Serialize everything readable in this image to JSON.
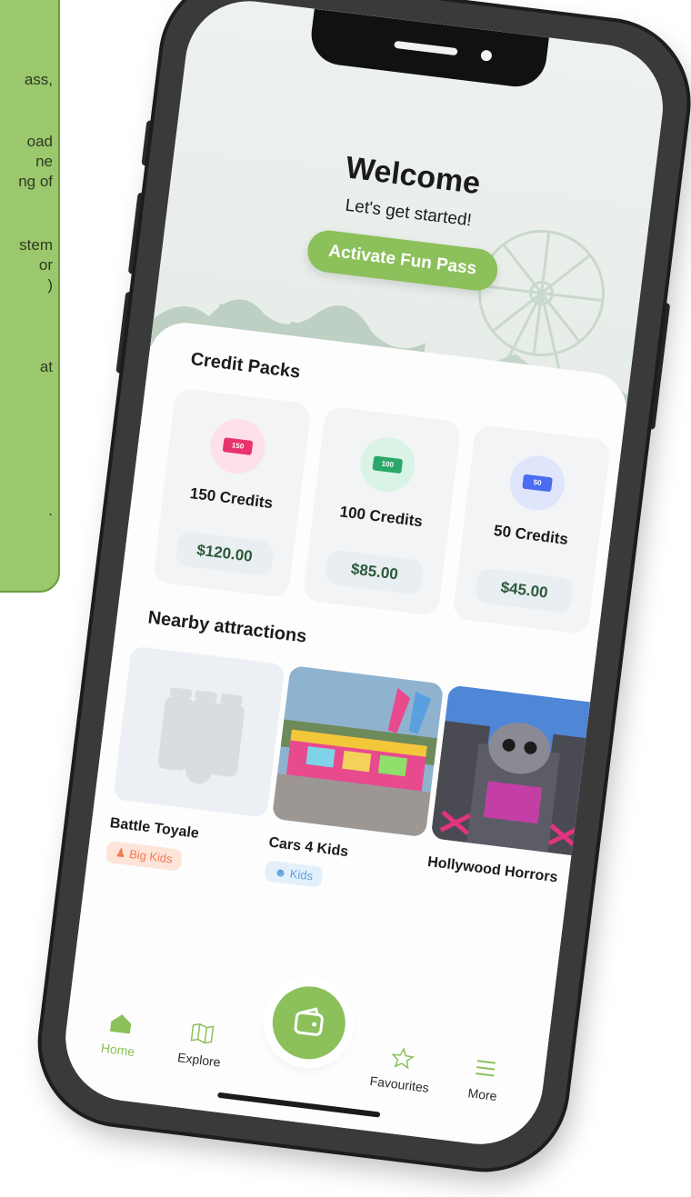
{
  "note": {
    "lines": [
      "ass,",
      "oad",
      "ne",
      "ng of",
      "stem",
      "or",
      ")",
      "at",
      "."
    ]
  },
  "hero": {
    "title": "Welcome",
    "subtitle": "Let's get started!",
    "cta_label": "Activate Fun Pass"
  },
  "credit_packs": {
    "title": "Credit Packs",
    "items": [
      {
        "ticket": "150",
        "label": "150 Credits",
        "price": "$120.00",
        "color": "#e8336d",
        "bg": "#fde0ea"
      },
      {
        "ticket": "100",
        "label": "100 Credits",
        "price": "$85.00",
        "color": "#2aa86b",
        "bg": "#d9f3e7"
      },
      {
        "ticket": "50",
        "label": "50 Credits",
        "price": "$45.00",
        "color": "#4a6cf0",
        "bg": "#dfe6fb"
      }
    ]
  },
  "attractions": {
    "title": "Nearby attractions",
    "items": [
      {
        "name": "Battle Toyale",
        "tag": "Big Kids",
        "tag_icon": "person-icon",
        "tag_color": "#f07b52",
        "tag_bg": "#fde4d9"
      },
      {
        "name": "Cars 4 Kids",
        "tag": "Kids",
        "tag_icon": "kids-icon",
        "tag_color": "#5aa0e0",
        "tag_bg": "#e3f0fb"
      },
      {
        "name": "Hollywood Horrors",
        "tag": "",
        "tag_icon": "",
        "tag_color": "",
        "tag_bg": ""
      }
    ]
  },
  "tabbar": {
    "home": "Home",
    "explore": "Explore",
    "favourites": "Favourites",
    "more": "More",
    "accent": "#8cc05b"
  }
}
